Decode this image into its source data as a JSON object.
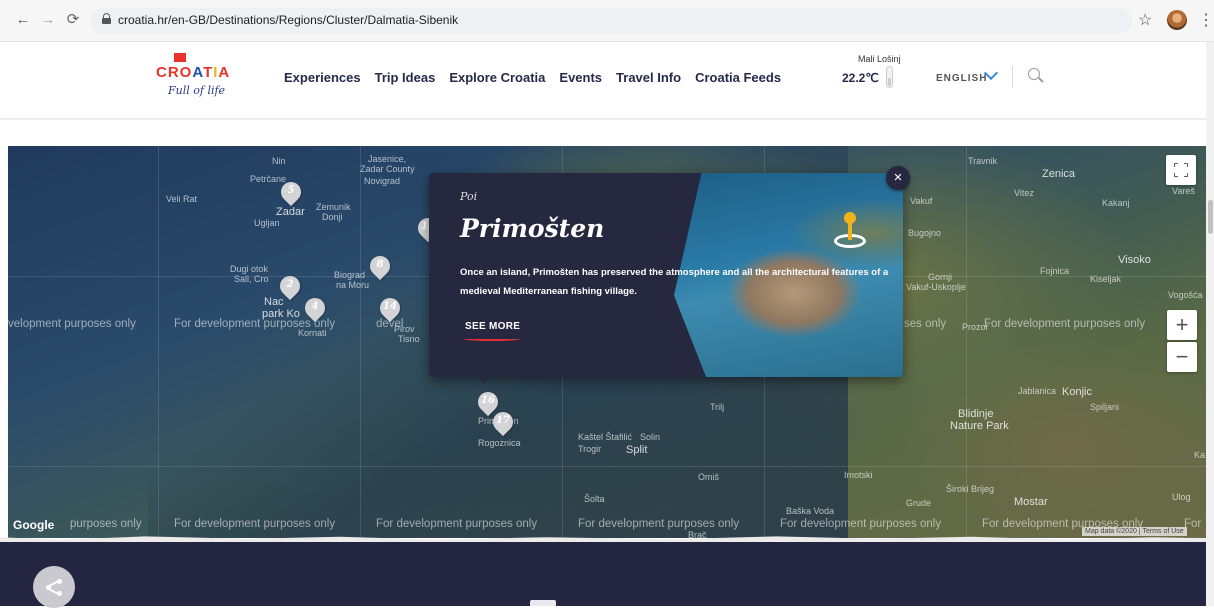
{
  "browser": {
    "url": "croatia.hr/en-GB/Destinations/Regions/Cluster/Dalmatia-Sibenik",
    "back_icon": "arrow-left-icon",
    "forward_icon": "arrow-right-icon",
    "reload_icon": "reload-icon"
  },
  "header": {
    "logo_word_red1": "CRO",
    "logo_word_blue": "A",
    "logo_word_red2": "T",
    "logo_word_yellow": "I",
    "logo_word_red3": "A",
    "logo_slogan": "Full of life",
    "nav": [
      "Experiences",
      "Trip Ideas",
      "Explore Croatia",
      "Events",
      "Travel Info",
      "Croatia Feeds"
    ],
    "weather_location": "Mali Lošinj",
    "weather_temp": "22.2℃",
    "language": "ENGLISH"
  },
  "map": {
    "dev_watermark": "For development purposes only",
    "dev_watermark_partial_left": "velopment purposes only",
    "dev_watermark_partial_1": "For development purposes only",
    "dev_watermark_partial_2": "devel",
    "dev_watermark_partial_3": "ses only",
    "dev_watermark_partial_bl": "purposes only",
    "dev_watermark_partial_br": "For",
    "places": {
      "nin": "Nin",
      "jasenice": "Jasenice,",
      "zadar_county": "Zadar County",
      "novigrad": "Novigrad",
      "petrcane": "Petrčane",
      "veli_rat": "Veli Rat",
      "ugljan": "Ugljan",
      "zadar": "Zadar",
      "zemunik": "Zemunik",
      "donji": "Donji",
      "dugi_otok": "Dugi otok",
      "sali_cro": "Sali, Cro",
      "biograd": "Biograd",
      "na_moru": "na Moru",
      "nac": "Nac",
      "park_ko": "park Ko",
      "kornati": "Kornati",
      "tisno": "Tisno",
      "primosten": "Primošten",
      "rogoznica": "Rogoznica",
      "kastel": "Kaštel Štafilić",
      "solin": "Solin",
      "trogir": "Trogir",
      "split": "Split",
      "trilj": "Trilj",
      "omis": "Omiš",
      "imotski": "Imotski",
      "solta": "Šolta",
      "brac": "Brač",
      "baska_voda": "Baška Voda",
      "grude": "Grude",
      "siroki": "Široki Brijeg",
      "mostar": "Mostar",
      "travnik": "Travnik",
      "zenica": "Zenica",
      "vitez": "Vitez",
      "vares": "Vareš",
      "kakanj": "Kakanj",
      "vakuf": "Vakuf",
      "bugojno": "Bugojno",
      "gornji": "Gornji",
      "vakuf_uskoplje": "Vakuf-Uskoplje",
      "fojnica": "Fojnica",
      "kiseljak": "Kiseljak",
      "visoko": "Visoko",
      "vogosca": "Vogošća",
      "prozor": "Prozor",
      "jablanica": "Jablanica",
      "konjic": "Konjic",
      "spiljani": "Spiljani",
      "blidinje": "Blidinje",
      "nature_park": "Nature Park",
      "ka": "Ka",
      "ulog": "Ulog",
      "pirov": "Pirov"
    },
    "markers": [
      "5",
      "16",
      "8",
      "2",
      "4",
      "14",
      "16",
      "17"
    ],
    "fullscreen_icon": "fullscreen-icon",
    "zoom_in": "+",
    "zoom_out": "−",
    "google": "Google",
    "attribution": "Map data ©2020 | Terms of Use"
  },
  "popup": {
    "tag": "Poi",
    "title": "Primošten",
    "description": "Once an island, Primošten has preserved the atmosphere and all the architectural features of a medieval Mediterranean fishing village.",
    "cta": "SEE MORE",
    "close": "×",
    "icon": "map-pin-target-icon"
  },
  "footer": {
    "share_icon": "share-icon"
  },
  "colors": {
    "brand_red": "#e8332b",
    "brand_blue": "#1f4fa8",
    "brand_yellow": "#f2b21a",
    "navy": "#26283f",
    "lang_accent": "#3a8fd8"
  }
}
